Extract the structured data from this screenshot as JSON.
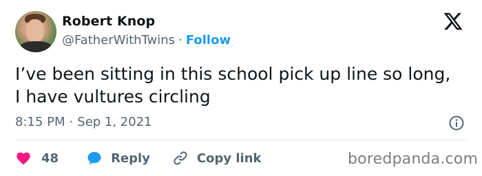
{
  "user": {
    "name": "Robert Knop",
    "handle": "@FatherWithTwins",
    "separator": "·",
    "follow_label": "Follow"
  },
  "tweet": {
    "text_line_1": "I’ve been sitting in this school pick up line so long,",
    "text_line_2": "I have vultures circling",
    "time": "8:15 PM",
    "date": "Sep 1, 2021",
    "separator": "·"
  },
  "actions": {
    "like_count": "48",
    "reply_label": "Reply",
    "copy_link_label": "Copy link"
  },
  "watermark": "boredpanda.com",
  "icons": {
    "brand": "x-logo-icon",
    "info": "info-icon",
    "like": "heart-icon",
    "reply": "speech-bubble-icon",
    "copy": "link-icon"
  },
  "colors": {
    "accent": "#1d9bf0",
    "like": "#f91880",
    "muted": "#536471",
    "text": "#0f1419"
  }
}
